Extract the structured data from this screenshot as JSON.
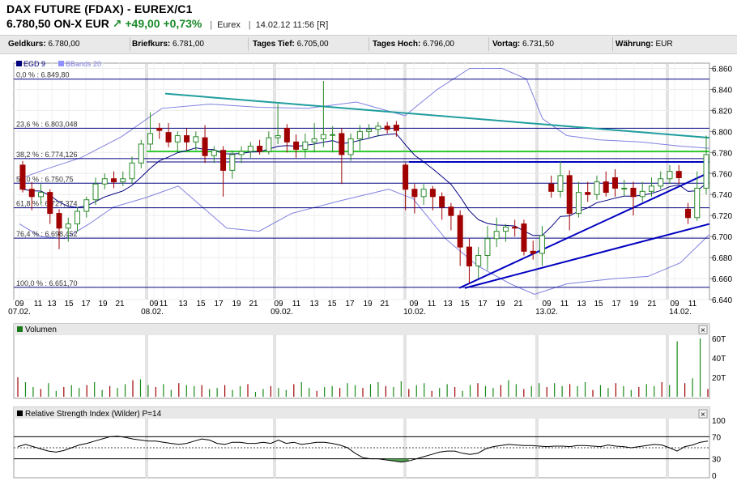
{
  "header": {
    "title": "DAX FUTURE (FDAX) - EUREX/C1",
    "price": "6.780,50 ON-X",
    "currency": "EUR",
    "change": "+49,00",
    "change_pct": "+0,73%",
    "exchange": "Eurex",
    "datetime": "14.02.12 11:56 [R]"
  },
  "infobar": [
    {
      "label": "Geldkurs:",
      "value": "6.780,00"
    },
    {
      "label": "Briefkurs:",
      "value": "6.781,00"
    },
    {
      "label": "Tages Tief:",
      "value": "6.705,00"
    },
    {
      "label": "Tages Hoch:",
      "value": "6.796,00"
    },
    {
      "label": "Vortag:",
      "value": "6.731,50"
    },
    {
      "label": "Währung:",
      "value": "EUR"
    }
  ],
  "colors": {
    "up": "#2a8a2a",
    "down": "#a00000",
    "ema": "#000080",
    "bbands": "#8080e0",
    "fib": "#000080",
    "trend_teal": "#1f9d9d",
    "trend_blue": "#0000c0",
    "green_line": "#33cc33",
    "rsi": "#000000"
  },
  "chart_data": [
    {
      "type": "candlestick",
      "legend": [
        "EGD 9",
        "BBands 20"
      ],
      "y_ticks": [
        "6.860",
        "6.840",
        "6.820",
        "6.800",
        "6.780",
        "6.760",
        "6.740",
        "6.720",
        "6.700",
        "6.680",
        "6.660",
        "6.640"
      ],
      "ylim": [
        6640,
        6865
      ],
      "x_hours": [
        "09",
        "11",
        "13",
        "15",
        "17",
        "19",
        "21",
        "09",
        "11",
        "13",
        "15",
        "17",
        "19",
        "21",
        "09",
        "11",
        "13",
        "15",
        "17",
        "19",
        "21",
        "09",
        "11",
        "13",
        "15",
        "17",
        "19",
        "21",
        "09",
        "11",
        "13",
        "15",
        "17",
        "19",
        "21",
        "09",
        "11"
      ],
      "x_dates": [
        "07.02.",
        "08.02.",
        "09.02.",
        "10.02.",
        "13.02.",
        "14.02."
      ],
      "fib_levels": [
        {
          "label": "0,0 % : 6.849,80",
          "value": 6849.8
        },
        {
          "label": "23,6 % : 6.803,048",
          "value": 6803.048
        },
        {
          "label": "38,2 % : 6.774,126",
          "value": 6774.126
        },
        {
          "label": "50,0 % : 6.750,75",
          "value": 6750.75
        },
        {
          "label": "61,8 % : 6.727,374",
          "value": 6727.374
        },
        {
          "label": "76,4 % : 6.698,452",
          "value": 6698.452
        },
        {
          "label": "100,0 % : 6.651,70",
          "value": 6651.7
        }
      ],
      "candles": [
        [
          6768,
          6745,
          6772,
          6742
        ],
        [
          6745,
          6738,
          6752,
          6725
        ],
        [
          6738,
          6742,
          6750,
          6730
        ],
        [
          6742,
          6722,
          6745,
          6712
        ],
        [
          6722,
          6708,
          6726,
          6688
        ],
        [
          6708,
          6712,
          6718,
          6695
        ],
        [
          6712,
          6724,
          6728,
          6705
        ],
        [
          6724,
          6735,
          6738,
          6718
        ],
        [
          6735,
          6750,
          6756,
          6730
        ],
        [
          6750,
          6755,
          6760,
          6745
        ],
        [
          6755,
          6752,
          6762,
          6746
        ],
        [
          6752,
          6755,
          6762,
          6748
        ],
        [
          6755,
          6770,
          6776,
          6750
        ],
        [
          6770,
          6788,
          6792,
          6765
        ],
        [
          6788,
          6798,
          6818,
          6782
        ],
        [
          6803,
          6801,
          6808,
          6793
        ],
        [
          6799,
          6790,
          6808,
          6785
        ],
        [
          6790,
          6796,
          6800,
          6780
        ],
        [
          6796,
          6790,
          6803,
          6782
        ],
        [
          6790,
          6795,
          6800,
          6782
        ],
        [
          6794,
          6777,
          6806,
          6770
        ],
        [
          6777,
          6782,
          6786,
          6770
        ],
        [
          6782,
          6763,
          6786,
          6738
        ],
        [
          6763,
          6778,
          6782,
          6755
        ],
        [
          6778,
          6781,
          6786,
          6770
        ],
        [
          6781,
          6786,
          6790,
          6775
        ],
        [
          6786,
          6781,
          6792,
          6778
        ],
        [
          6781,
          6794,
          6800,
          6778
        ],
        [
          6794,
          6796,
          6826,
          6788
        ],
        [
          6803,
          6790,
          6807,
          6780
        ],
        [
          6790,
          6783,
          6797,
          6775
        ],
        [
          6783,
          6790,
          6798,
          6775
        ],
        [
          6790,
          6793,
          6808,
          6780
        ],
        [
          6793,
          6797,
          6848,
          6785
        ],
        [
          6797,
          6797,
          6805,
          6780
        ],
        [
          6798,
          6778,
          6803,
          6750
        ],
        [
          6778,
          6793,
          6798,
          6772
        ],
        [
          6793,
          6800,
          6806,
          6782
        ],
        [
          6800,
          6802,
          6807,
          6793
        ],
        [
          6802,
          6805,
          6809,
          6795
        ],
        [
          6805,
          6802,
          6809,
          6798
        ],
        [
          6806,
          6801,
          6810,
          6795
        ],
        [
          6768,
          6745,
          6770,
          6725
        ],
        [
          6745,
          6738,
          6750,
          6722
        ],
        [
          6738,
          6745,
          6750,
          6730
        ],
        [
          6745,
          6738,
          6748,
          6725
        ],
        [
          6738,
          6728,
          6742,
          6716
        ],
        [
          6728,
          6720,
          6732,
          6706
        ],
        [
          6720,
          6690,
          6725,
          6672
        ],
        [
          6690,
          6672,
          6698,
          6655
        ],
        [
          6672,
          6682,
          6690,
          6660
        ],
        [
          6682,
          6698,
          6710,
          6668
        ],
        [
          6698,
          6705,
          6718,
          6690
        ],
        [
          6705,
          6709,
          6712,
          6695
        ],
        [
          6709,
          6708,
          6716,
          6700
        ],
        [
          6712,
          6686,
          6716,
          6682
        ],
        [
          6686,
          6684,
          6696,
          6678
        ],
        [
          6684,
          6701,
          6710,
          6672
        ],
        [
          6750,
          6743,
          6758,
          6737
        ],
        [
          6743,
          6758,
          6772,
          6737
        ],
        [
          6758,
          6722,
          6763,
          6706
        ],
        [
          6722,
          6742,
          6752,
          6718
        ],
        [
          6742,
          6740,
          6752,
          6733
        ],
        [
          6740,
          6752,
          6758,
          6735
        ],
        [
          6752,
          6742,
          6762,
          6738
        ],
        [
          6756,
          6746,
          6764,
          6738
        ],
        [
          6746,
          6746,
          6754,
          6738
        ],
        [
          6746,
          6738,
          6752,
          6720
        ],
        [
          6738,
          6743,
          6752,
          6733
        ],
        [
          6743,
          6748,
          6756,
          6738
        ],
        [
          6748,
          6755,
          6762,
          6745
        ],
        [
          6755,
          6762,
          6768,
          6750
        ],
        [
          6762,
          6756,
          6768,
          6750
        ],
        [
          6726,
          6718,
          6732,
          6712
        ],
        [
          6718,
          6746,
          6762,
          6715
        ],
        [
          6746,
          6778,
          6796,
          6740
        ]
      ]
    },
    {
      "type": "bar",
      "title": "Volumen",
      "y_ticks": [
        "60T",
        "40T",
        "20T"
      ],
      "values": [
        20,
        15,
        10,
        8,
        14,
        6,
        10,
        12,
        9,
        12,
        15,
        7,
        11,
        9,
        13,
        17,
        18,
        12,
        10,
        13,
        7,
        14,
        12,
        11,
        12,
        8,
        9,
        12,
        7,
        11,
        13,
        5,
        8,
        11,
        9,
        7,
        13,
        15,
        9,
        6,
        10,
        11,
        9,
        14,
        12,
        9,
        13,
        15,
        11,
        10,
        16,
        8,
        12,
        14,
        6,
        9,
        13,
        10,
        6,
        12,
        14,
        11,
        9,
        12,
        17,
        13,
        8,
        11,
        14,
        10,
        14,
        11,
        13,
        11,
        15,
        7,
        12,
        9,
        14,
        11,
        7,
        10,
        13,
        11,
        15,
        12,
        57,
        14,
        19,
        60,
        8
      ]
    },
    {
      "type": "line",
      "title": "Relative Strength Index (Wilder) P=14",
      "y_ticks": [
        "100",
        "70",
        "30",
        "0"
      ],
      "ylim": [
        0,
        100
      ],
      "levels": [
        70,
        30
      ],
      "values": [
        52,
        56,
        52,
        48,
        44,
        42,
        45,
        50,
        55,
        58,
        62,
        66,
        70,
        71,
        69,
        66,
        64,
        62,
        62,
        60,
        58,
        56,
        58,
        62,
        66,
        64,
        58,
        56,
        60,
        60,
        58,
        58,
        60,
        58,
        64,
        58,
        60,
        56,
        58,
        60,
        60,
        58,
        55,
        50,
        40,
        32,
        30,
        30,
        28,
        26,
        24,
        26,
        30,
        34,
        38,
        42,
        44,
        44,
        40,
        38,
        40,
        48,
        52,
        54,
        56,
        55,
        54,
        54,
        53,
        52,
        53,
        53,
        52,
        54,
        54,
        53,
        52,
        55,
        53,
        52,
        50,
        52,
        54,
        56,
        55,
        50,
        44,
        52,
        55,
        60,
        62
      ]
    }
  ]
}
